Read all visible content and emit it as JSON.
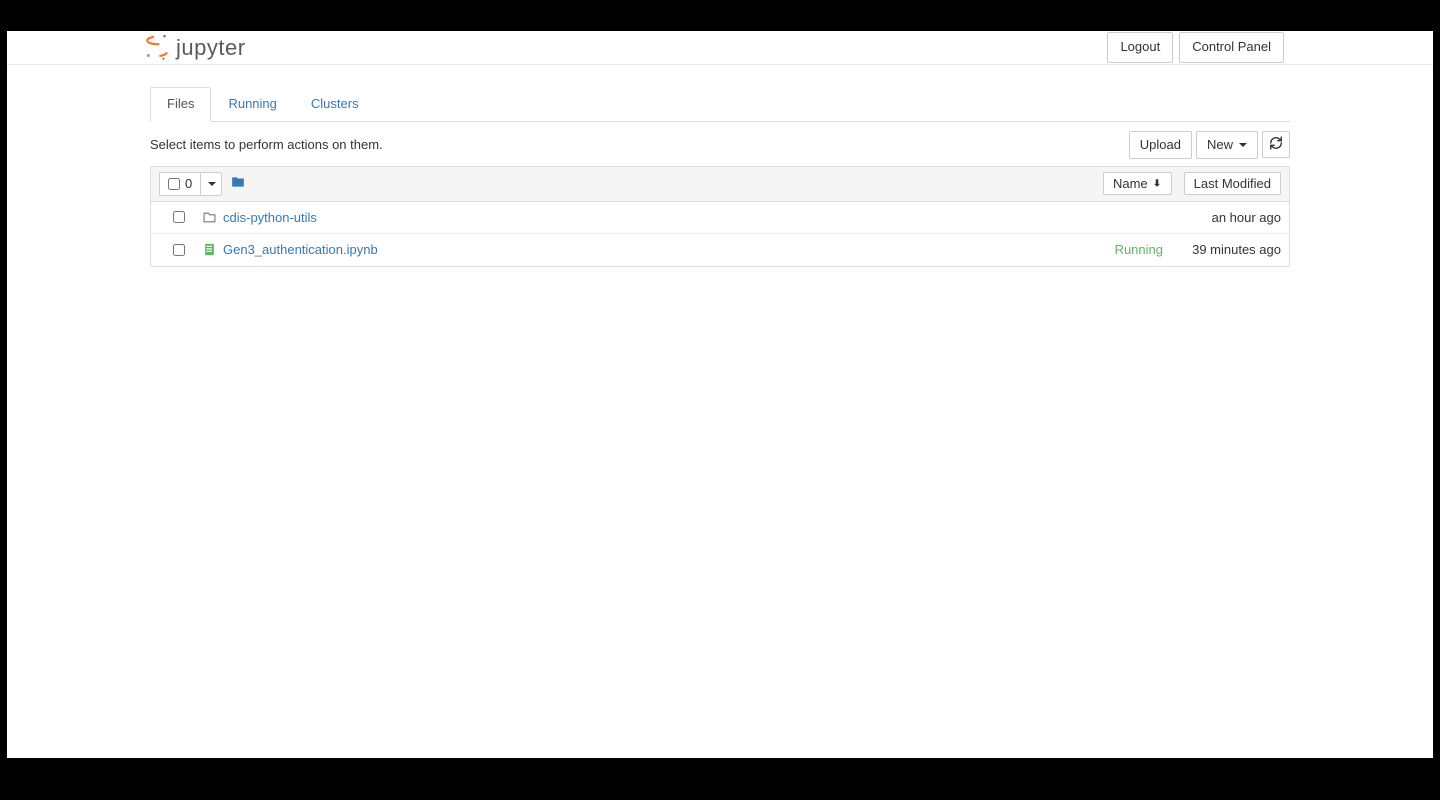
{
  "header": {
    "brand": "jupyter",
    "logout": "Logout",
    "control_panel": "Control Panel"
  },
  "tabs": [
    {
      "label": "Files",
      "active": true
    },
    {
      "label": "Running",
      "active": false
    },
    {
      "label": "Clusters",
      "active": false
    }
  ],
  "hint": "Select items to perform actions on them.",
  "toolbar": {
    "upload": "Upload",
    "new": "New"
  },
  "listing_header": {
    "selected_count": "0",
    "name_label": "Name",
    "modified_label": "Last Modified"
  },
  "items": [
    {
      "type": "folder",
      "name": "cdis-python-utils",
      "status": "",
      "modified": "an hour ago"
    },
    {
      "type": "notebook",
      "name": "Gen3_authentication.ipynb",
      "status": "Running",
      "modified": "39 minutes ago"
    }
  ],
  "colors": {
    "link": "#337ab7",
    "running": "#5cb85c",
    "brand_orange": "#f37626"
  }
}
